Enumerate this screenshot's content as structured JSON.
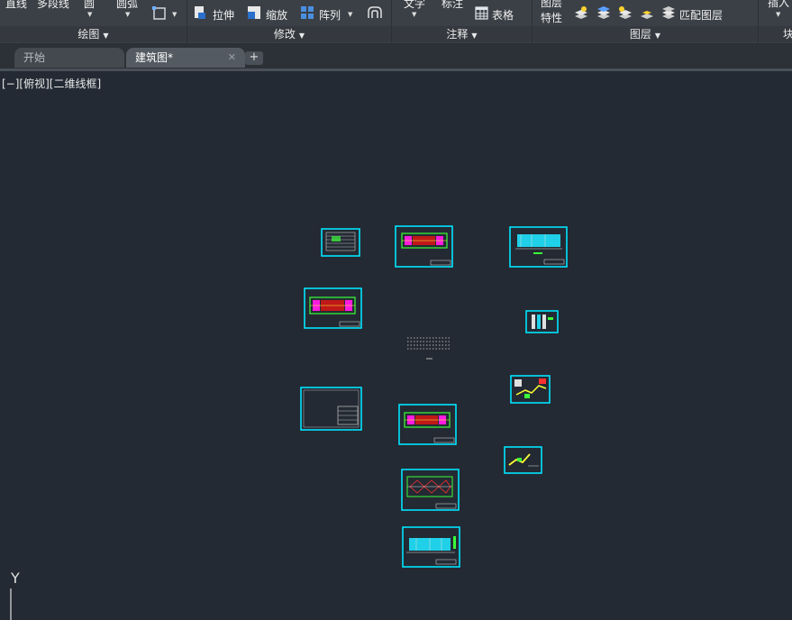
{
  "ribbon": {
    "draw": {
      "title": "绘图",
      "line": "直线",
      "polyline": "多段线",
      "circle": "圆",
      "arc": "圆弧"
    },
    "modify": {
      "title": "修改",
      "stretch": "拉伸",
      "scale": "缩放",
      "array": "阵列"
    },
    "annotate": {
      "title": "注释",
      "text": "文字",
      "dimension": "标注",
      "table": "表格"
    },
    "layers": {
      "title": "图层",
      "properties_top": "图层",
      "properties": "特性",
      "match": "匹配图层"
    },
    "block": {
      "title": "块",
      "insert": "插入"
    }
  },
  "tabs": [
    {
      "label": "开始",
      "active": false
    },
    {
      "label": "建筑图*",
      "active": true
    }
  ],
  "viewport": {
    "label": "[−][俯视][二维线框]",
    "ucs_axis": "Y"
  },
  "colors": {
    "background": "#232a33",
    "sheet_frame": "#00e5ff",
    "ribbon": "#3b4046"
  }
}
